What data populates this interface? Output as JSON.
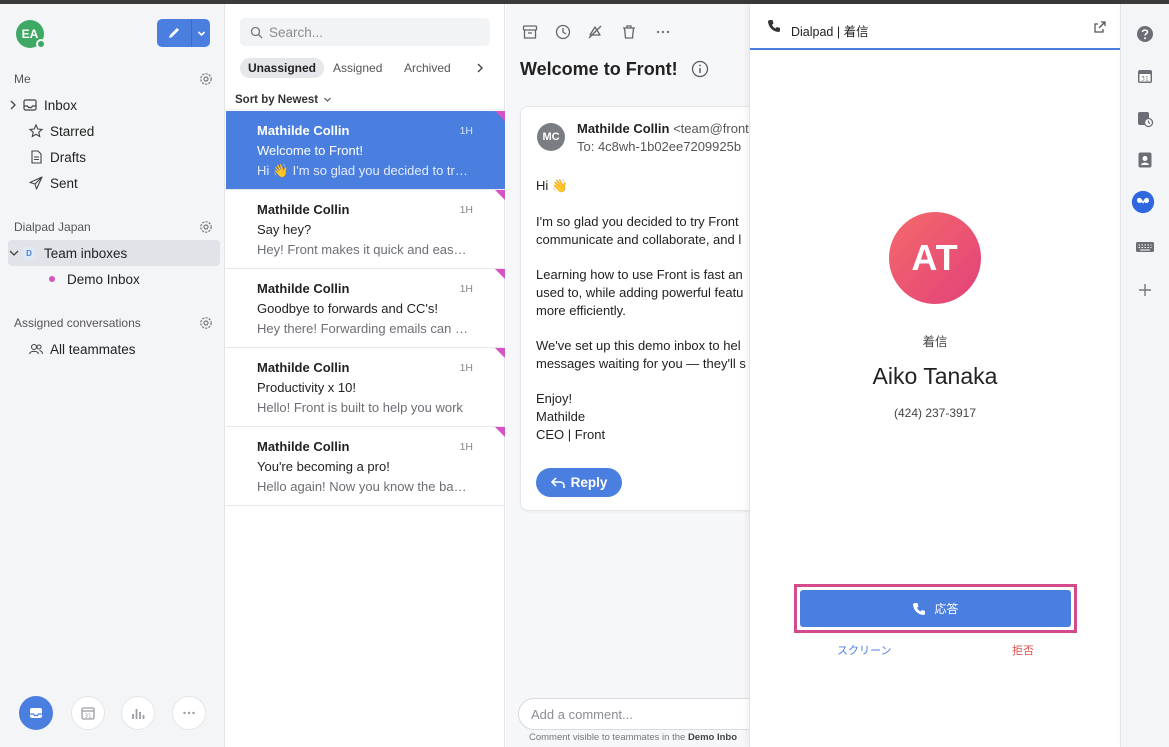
{
  "sidebar": {
    "avatar_initials": "EA",
    "me_header": "Me",
    "me_items": [
      {
        "label": "Inbox",
        "icon": "inbox-icon"
      },
      {
        "label": "Starred",
        "icon": "star-icon"
      },
      {
        "label": "Drafts",
        "icon": "drafts-icon"
      },
      {
        "label": "Sent",
        "icon": "sent-icon"
      }
    ],
    "workspace_header": "Dialpad Japan",
    "team_inboxes_label": "Team inboxes",
    "team_badge": "D",
    "demo_inbox_label": "Demo Inbox",
    "assigned_header": "Assigned conversations",
    "all_teammates_label": "All teammates",
    "bottom_icons": [
      "inbox-icon",
      "calendar-icon",
      "analytics-icon",
      "more-icon"
    ],
    "calendar_day": "31"
  },
  "list": {
    "search_placeholder": "Search...",
    "tabs": [
      "Unassigned",
      "Assigned",
      "Archived"
    ],
    "sort_label": "Sort by Newest",
    "conversations": [
      {
        "name": "Mathilde Collin",
        "time": "1H",
        "subject": "Welcome to Front!",
        "preview": "Hi 👋 I'm so glad you decided to try Front"
      },
      {
        "name": "Mathilde Collin",
        "time": "1H",
        "subject": "Say hey?",
        "preview": "Hey! Front makes it quick and easy to"
      },
      {
        "name": "Mathilde Collin",
        "time": "1H",
        "subject": "Goodbye to forwards and CC's!",
        "preview": "Hey there! Forwarding emails can get"
      },
      {
        "name": "Mathilde Collin",
        "time": "1H",
        "subject": "Productivity x 10!",
        "preview": "Hello! Front is built to help you work"
      },
      {
        "name": "Mathilde Collin",
        "time": "1H",
        "subject": "You're becoming a pro!",
        "preview": "Hello again! Now you know the basics"
      }
    ]
  },
  "message": {
    "title": "Welcome to Front!",
    "avatar_initials": "MC",
    "from_name": "Mathilde Collin",
    "from_email": "<team@frontapp.com>",
    "to": "To: 4c8wh-1b02ee7209925b",
    "body": [
      "Hi 👋",
      "I'm so glad you decided to try Front",
      "communicate and collaborate, and l",
      "Learning how to use Front is fast an",
      "used to, while adding powerful featu",
      "more efficiently.",
      "We've set up this demo inbox to hel",
      "messages waiting for you — they'll s",
      "Enjoy!",
      "Mathilde",
      "CEO | Front"
    ],
    "reply_label": "Reply",
    "comment_placeholder": "Add a comment...",
    "comment_note_prefix": "Comment visible to teammates in the",
    "comment_note_inbox": "Demo Inbo"
  },
  "dialpad": {
    "title": "Dialpad | 着信",
    "caller_initials": "AT",
    "status": "着信",
    "caller_name": "Aiko Tanaka",
    "caller_number": "(424) 237-3917",
    "answer_label": "応答",
    "screen_label": "スクリーン",
    "decline_label": "拒否",
    "accent": "#4a7fe0",
    "decline_color": "#d9534f",
    "highlight_color": "#d44a8a"
  },
  "rail": {
    "icons": [
      "help-icon",
      "calendar-icon",
      "calendar-clock-icon",
      "contact-icon",
      "dialpad-icon",
      "keyboard-icon",
      "add-icon"
    ],
    "calendar_day": "31"
  }
}
